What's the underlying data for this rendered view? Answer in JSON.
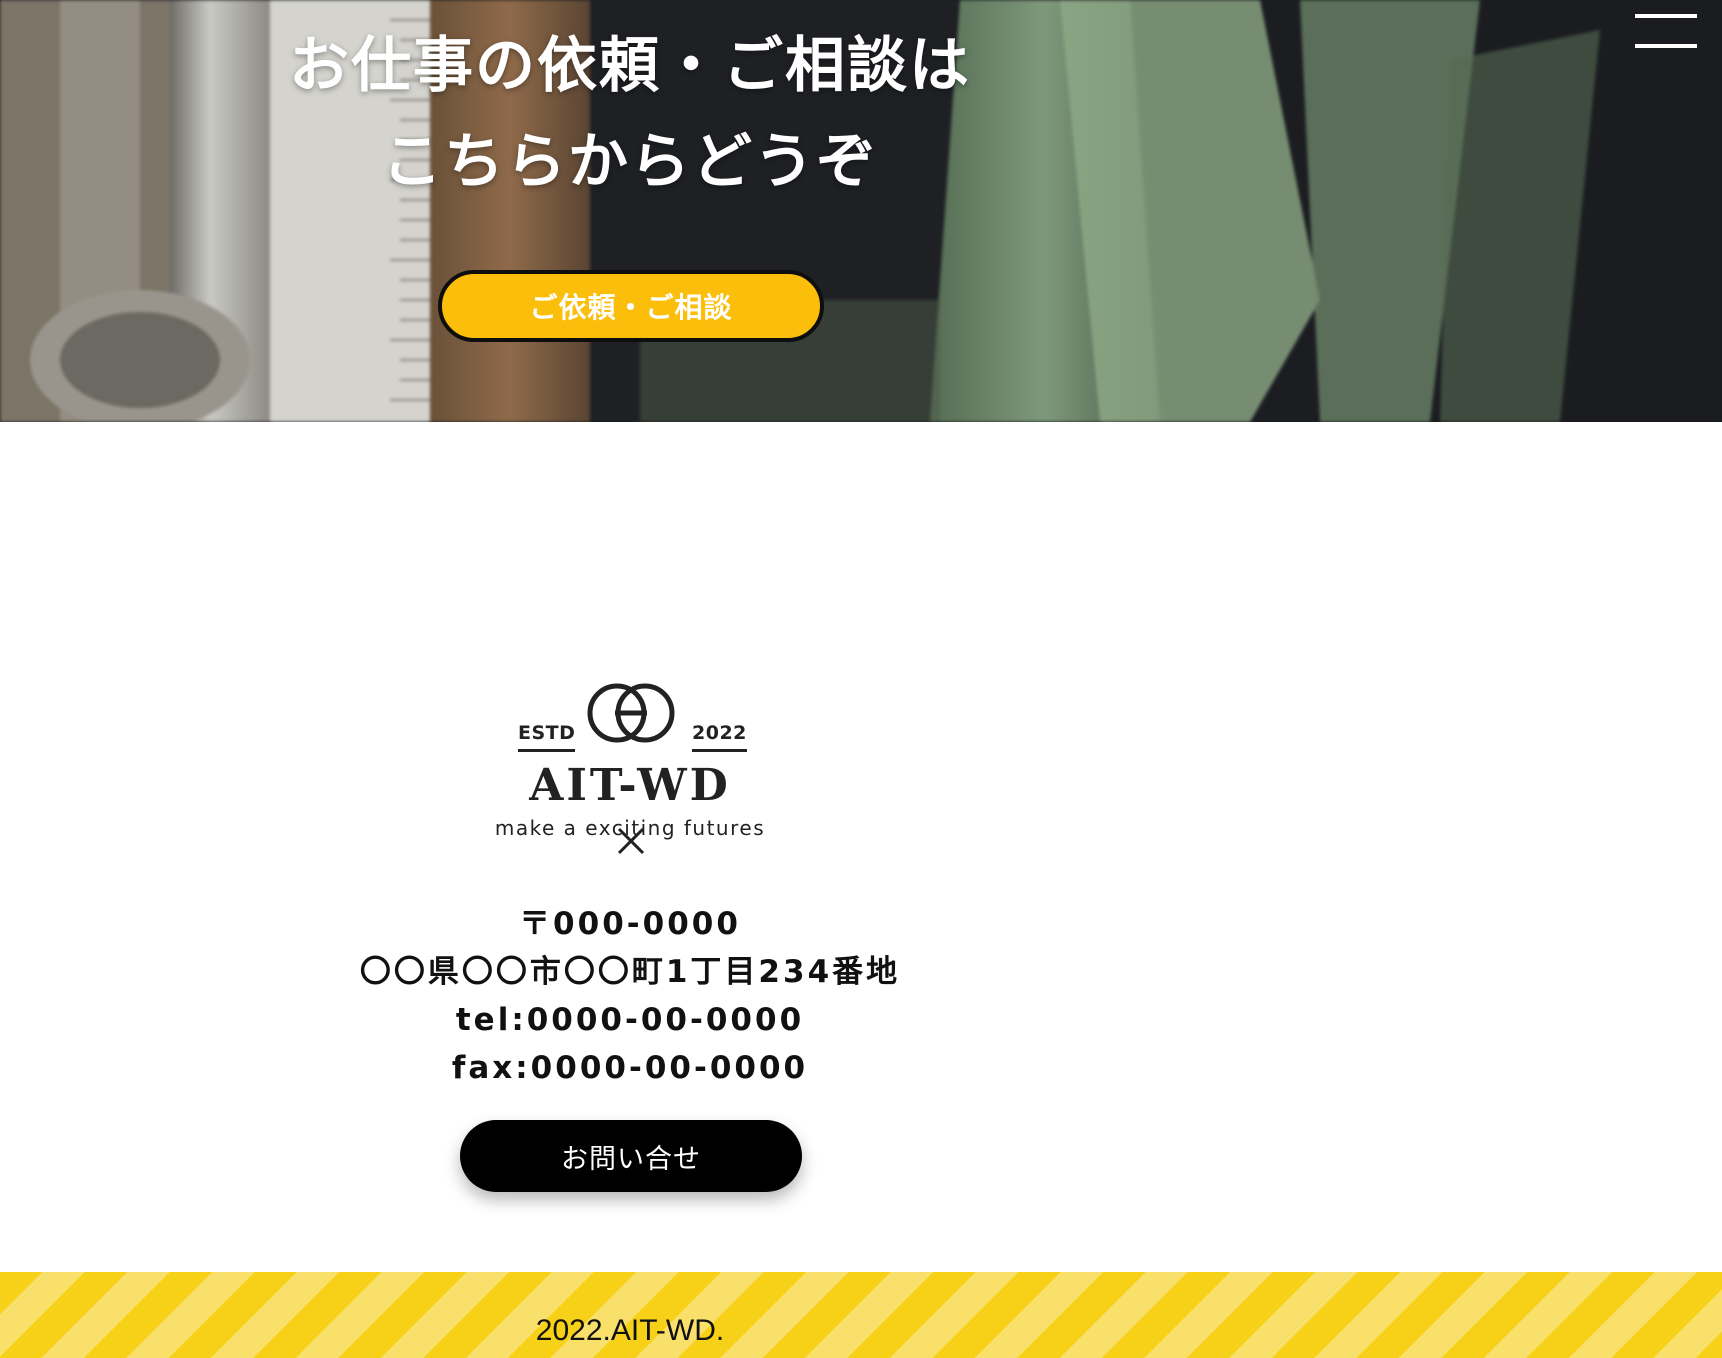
{
  "hero": {
    "title_line1": "お仕事の依頼・ご相談は",
    "title_line2": "こちらからどうぞ",
    "consult_button_label": "ご依頼・ご相談"
  },
  "nav": {
    "menu_icon": "hamburger-menu-icon"
  },
  "logo": {
    "estd": "ESTD",
    "year": "2022",
    "name": "AIT-WD",
    "tagline": "make a exciting futures",
    "collab_symbol_icon": "cross-icon"
  },
  "address": {
    "postal": "〒000-0000",
    "street": "〇〇県〇〇市〇〇町1丁目234番地",
    "tel": "tel:0000-00-0000",
    "fax": "fax:0000-00-0000"
  },
  "contact": {
    "inquiry_button_label": "お問い合せ"
  },
  "footer": {
    "copyright": "2022.AIT-WD."
  },
  "colors": {
    "accent_yellow": "#fbbe0a",
    "stripe_yellow": "#f7d018",
    "stripe_light": "#f9e06a",
    "text_dark": "#111111"
  }
}
